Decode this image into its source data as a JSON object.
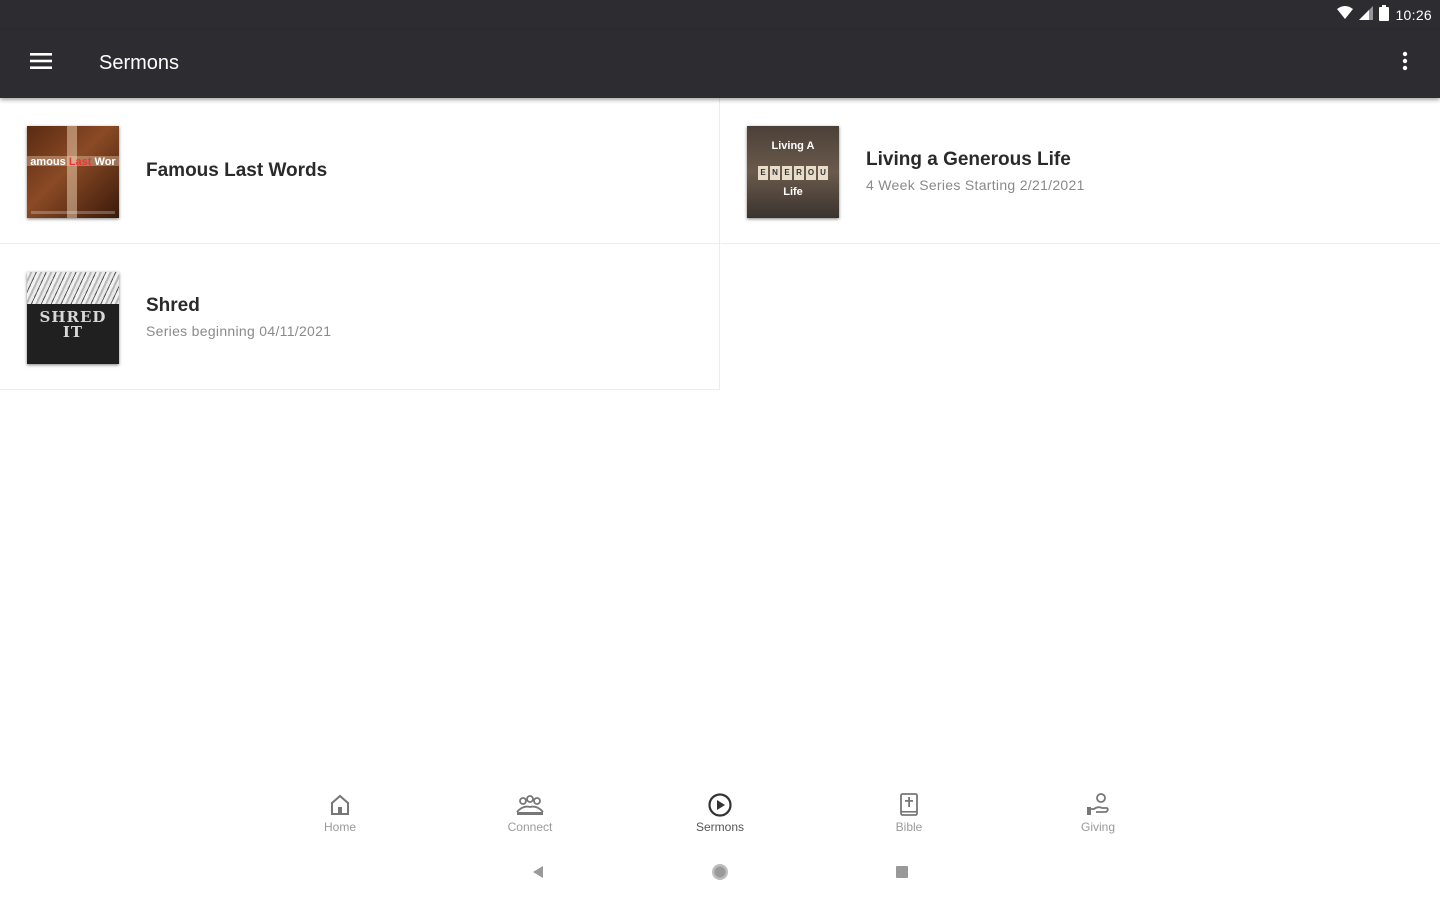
{
  "status_bar": {
    "time": "10:26",
    "icons": [
      "wifi-icon",
      "cell-signal-icon",
      "battery-icon"
    ]
  },
  "app_bar": {
    "title": "Sermons",
    "menu_icon": "hamburger-menu-icon",
    "overflow_icon": "more-vert-icon",
    "background": "#2d2c31"
  },
  "series": [
    {
      "title": "Famous Last Words",
      "subtitle": "",
      "thumb_text": {
        "left": "amous",
        "accent": "Last",
        "right": "Wor"
      }
    },
    {
      "title": "Living a Generous Life",
      "subtitle": "4 Week Series Starting 2/21/2021",
      "thumb_text": {
        "line1": "Living A",
        "tiles": [
          "E",
          "N",
          "E",
          "R",
          "O",
          "U"
        ],
        "line3": "Life"
      }
    },
    {
      "title": "Shred",
      "subtitle": "Series beginning 04/11/2021",
      "thumb_text": {
        "line1": "SHRED",
        "line2": "IT"
      }
    }
  ],
  "bottom_nav": {
    "items": [
      {
        "label": "Home",
        "icon": "home-icon",
        "active": false
      },
      {
        "label": "Connect",
        "icon": "people-icon",
        "active": false
      },
      {
        "label": "Sermons",
        "icon": "play-circle-icon",
        "active": true
      },
      {
        "label": "Bible",
        "icon": "bible-icon",
        "active": false
      },
      {
        "label": "Giving",
        "icon": "giving-hand-icon",
        "active": false
      }
    ]
  },
  "system_nav": {
    "icons": [
      "back-icon",
      "home-circle-icon",
      "recents-icon"
    ]
  }
}
